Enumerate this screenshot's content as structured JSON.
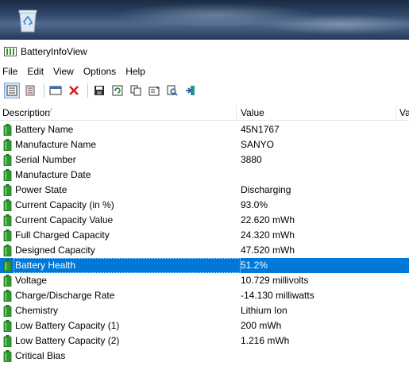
{
  "window": {
    "title": "BatteryInfoView"
  },
  "menu": [
    "File",
    "Edit",
    "View",
    "Options",
    "Help"
  ],
  "toolbar": {
    "buttons": [
      {
        "name": "properties-view-button",
        "icon": "properties-view-icon",
        "selected": true
      },
      {
        "name": "log-view-button",
        "icon": "log-view-icon",
        "selected": false
      },
      {
        "name": "html-report-button",
        "icon": "report-icon",
        "selected": false
      },
      {
        "name": "delete-button",
        "icon": "close-icon",
        "selected": false
      },
      {
        "name": "save-button",
        "icon": "save-icon",
        "selected": false
      },
      {
        "name": "refresh-button",
        "icon": "refresh-icon",
        "selected": false
      },
      {
        "name": "copy-button",
        "icon": "copy-icon",
        "selected": false
      },
      {
        "name": "properties-button",
        "icon": "properties-icon",
        "selected": false
      },
      {
        "name": "find-button",
        "icon": "find-icon",
        "selected": false
      },
      {
        "name": "exit-button",
        "icon": "exit-icon",
        "selected": false
      }
    ]
  },
  "columns": {
    "description": "Description",
    "value": "Value",
    "value_cut": "Va"
  },
  "rows": [
    {
      "description": "Battery Name",
      "value": "45N1767"
    },
    {
      "description": "Manufacture Name",
      "value": "SANYO"
    },
    {
      "description": "Serial Number",
      "value": " 3880"
    },
    {
      "description": "Manufacture Date",
      "value": ""
    },
    {
      "description": "Power State",
      "value": "Discharging"
    },
    {
      "description": "Current Capacity (in %)",
      "value": "93.0%"
    },
    {
      "description": "Current Capacity Value",
      "value": "22.620 mWh"
    },
    {
      "description": "Full Charged Capacity",
      "value": "24.320 mWh"
    },
    {
      "description": "Designed Capacity",
      "value": "47.520 mWh"
    },
    {
      "description": "Battery Health",
      "value": "51.2%",
      "selected": true
    },
    {
      "description": "Voltage",
      "value": "10.729 millivolts"
    },
    {
      "description": "Charge/Discharge Rate",
      "value": "-14.130 milliwatts"
    },
    {
      "description": "Chemistry",
      "value": "Lithium Ion"
    },
    {
      "description": "Low Battery Capacity (1)",
      "value": "200 mWh"
    },
    {
      "description": "Low Battery Capacity (2)",
      "value": "1.216 mWh"
    },
    {
      "description": "Critical Bias",
      "value": ""
    }
  ],
  "colors": {
    "selection": "#0078d7",
    "battery_green": "#2f9a2f"
  }
}
